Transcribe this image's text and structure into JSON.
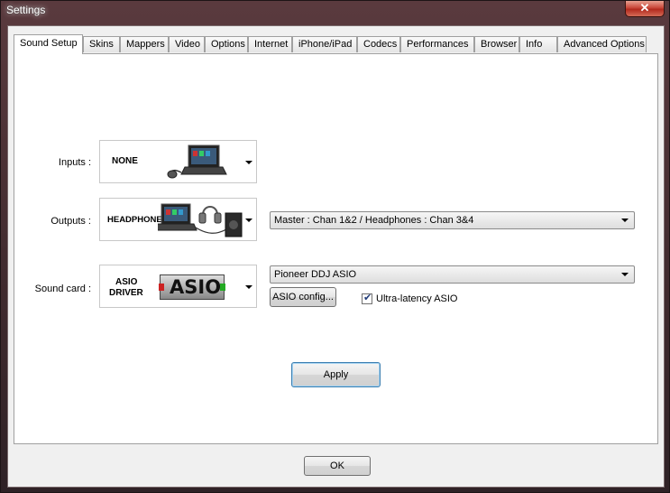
{
  "window": {
    "title": "Settings",
    "close_glyph": "✕"
  },
  "tabs": [
    {
      "label": "Sound Setup",
      "active": true
    },
    {
      "label": "Skins"
    },
    {
      "label": "Mappers"
    },
    {
      "label": "Video"
    },
    {
      "label": "Options"
    },
    {
      "label": "Internet"
    },
    {
      "label": "iPhone/iPad"
    },
    {
      "label": "Codecs"
    },
    {
      "label": "Performances"
    },
    {
      "label": "Browser"
    },
    {
      "label": "Info"
    },
    {
      "label": "Advanced Options"
    }
  ],
  "inputs": {
    "label": "Inputs :",
    "choice": "NONE"
  },
  "outputs": {
    "label": "Outputs :",
    "choice": "HEADPHONES",
    "channel_value": "Master : Chan 1&2 / Headphones : Chan 3&4"
  },
  "soundcard": {
    "label": "Sound card :",
    "choice_line1": "ASIO",
    "choice_line2": "DRIVER",
    "logo_text": "ASIO",
    "device_value": "Pioneer DDJ ASIO",
    "config_button": "ASIO config...",
    "ultra_latency_label": "Ultra-latency ASIO",
    "ultra_latency_checked": true
  },
  "apply_button": "Apply",
  "ok_button": "OK"
}
